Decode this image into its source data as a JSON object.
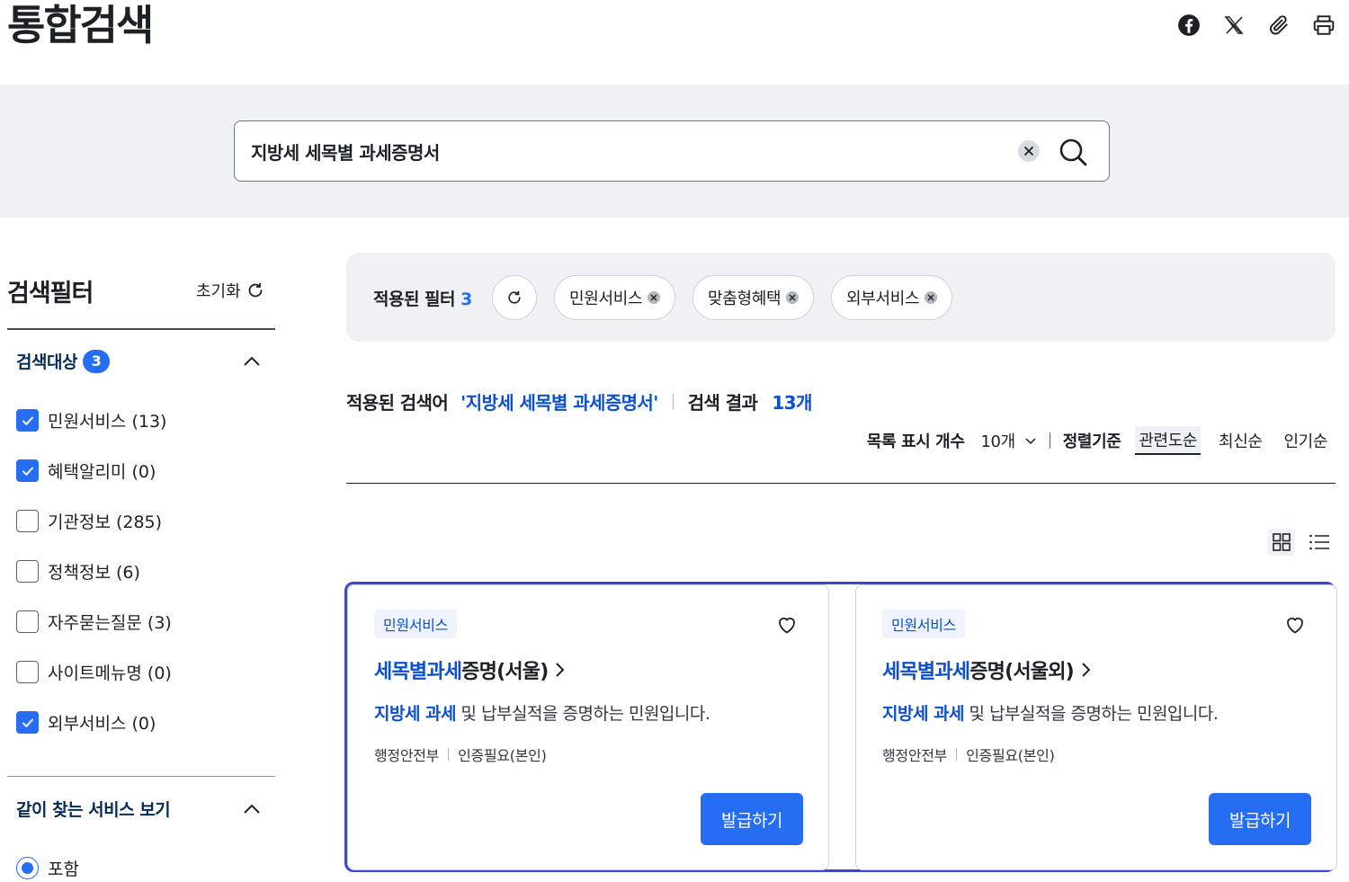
{
  "header": {
    "title": "통합검색",
    "share_icons": [
      "facebook-icon",
      "x-icon",
      "link-icon",
      "print-icon"
    ]
  },
  "search": {
    "value": "지방세 세목별 과세증명서",
    "placeholder": ""
  },
  "sidebar": {
    "title": "검색필터",
    "reset_label": "초기화",
    "target_section": {
      "title": "검색대상",
      "badge": "3",
      "items": [
        {
          "label": "민원서비스 (13)",
          "checked": true
        },
        {
          "label": "혜택알리미 (0)",
          "checked": true
        },
        {
          "label": "기관정보 (285)",
          "checked": false
        },
        {
          "label": "정책정보 (6)",
          "checked": false
        },
        {
          "label": "자주묻는질문 (3)",
          "checked": false
        },
        {
          "label": "사이트메뉴명 (0)",
          "checked": false
        },
        {
          "label": "외부서비스 (0)",
          "checked": true
        }
      ]
    },
    "related_section": {
      "title": "같이 찾는 서비스 보기",
      "option": "포함"
    }
  },
  "applied": {
    "label": "적용된 필터",
    "count": "3",
    "chips": [
      "민원서비스",
      "맞춤형혜택",
      "외부서비스"
    ]
  },
  "summary": {
    "keyword_label": "적용된 검색어",
    "keyword": "'지방세 세목별 과세증명서'",
    "result_label": "검색 결과",
    "result_count": "13개"
  },
  "sortbar": {
    "page_size_label": "목록 표시 개수",
    "page_size_value": "10개",
    "sort_label": "정렬기준",
    "options": [
      "관련도순",
      "최신순",
      "인기순"
    ],
    "active": "관련도순"
  },
  "cards": [
    {
      "tag": "민원서비스",
      "title_hl": "세목별과세",
      "title_rest": "증명(서울)",
      "desc_hl": "지방세 과세",
      "desc_rest": " 및 납부실적을 증명하는 민원입니다.",
      "org": "행정안전부",
      "auth": "인증필요(본인)",
      "button": "발급하기"
    },
    {
      "tag": "민원서비스",
      "title_hl": "세목별과세",
      "title_rest": "증명(서울외)",
      "desc_hl": "지방세 과세",
      "desc_rest": " 및 납부실적을 증명하는 민원입니다.",
      "org": "행정안전부",
      "auth": "인증필요(본인)",
      "button": "발급하기"
    }
  ],
  "colors": {
    "primary": "#256ef4",
    "highlight_text": "#0b50d0",
    "focus_outline": "#3847d8",
    "band_bg": "#eff1f4"
  }
}
